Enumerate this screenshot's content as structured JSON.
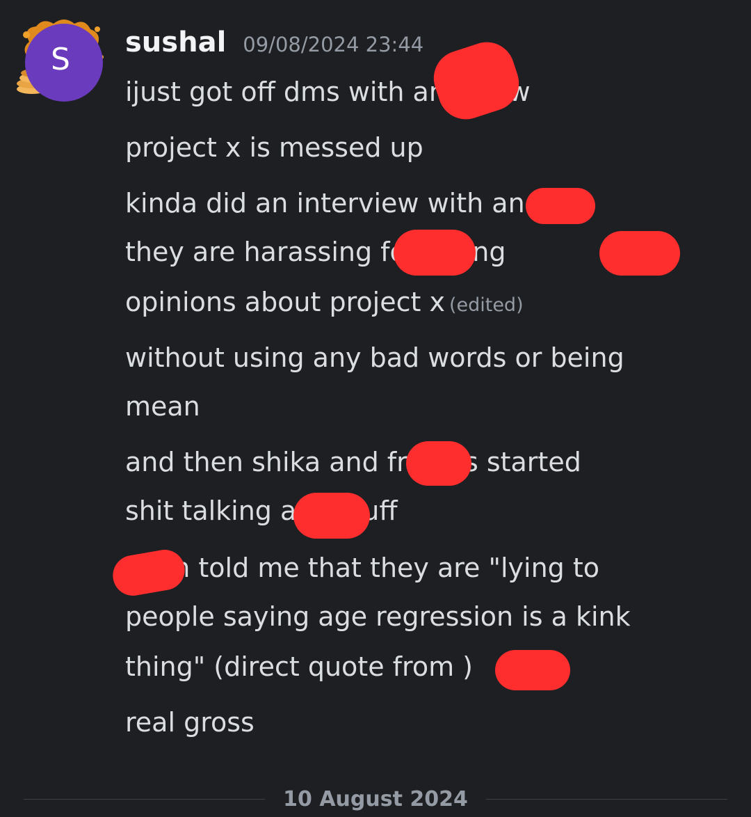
{
  "message": {
    "author": {
      "name": "sushal",
      "avatar_initial": "S",
      "avatar_color": "#6a3bbd"
    },
    "timestamp": "09/08/2024 23:44",
    "edited_label": "(edited)",
    "lines": [
      "ijust got off dms with        and wow",
      "project x is messed up",
      "kinda did an interview with       and",
      "they are harassing        for giving",
      "opinions about project x",
      "without using any bad words or being",
      "mean",
      "and then shika and       friends started",
      "shit talking         and stuff",
      "         even told me that they are \"lying to",
      "people saying age regression is a kink",
      "thing\" (direct quote from        )",
      "real gross"
    ]
  },
  "date_divider": {
    "label": "10 August 2024"
  },
  "colors": {
    "background": "#1e1f22",
    "text": "#dbdee1",
    "muted": "#949ba4",
    "redaction": "#ff2e2e"
  }
}
